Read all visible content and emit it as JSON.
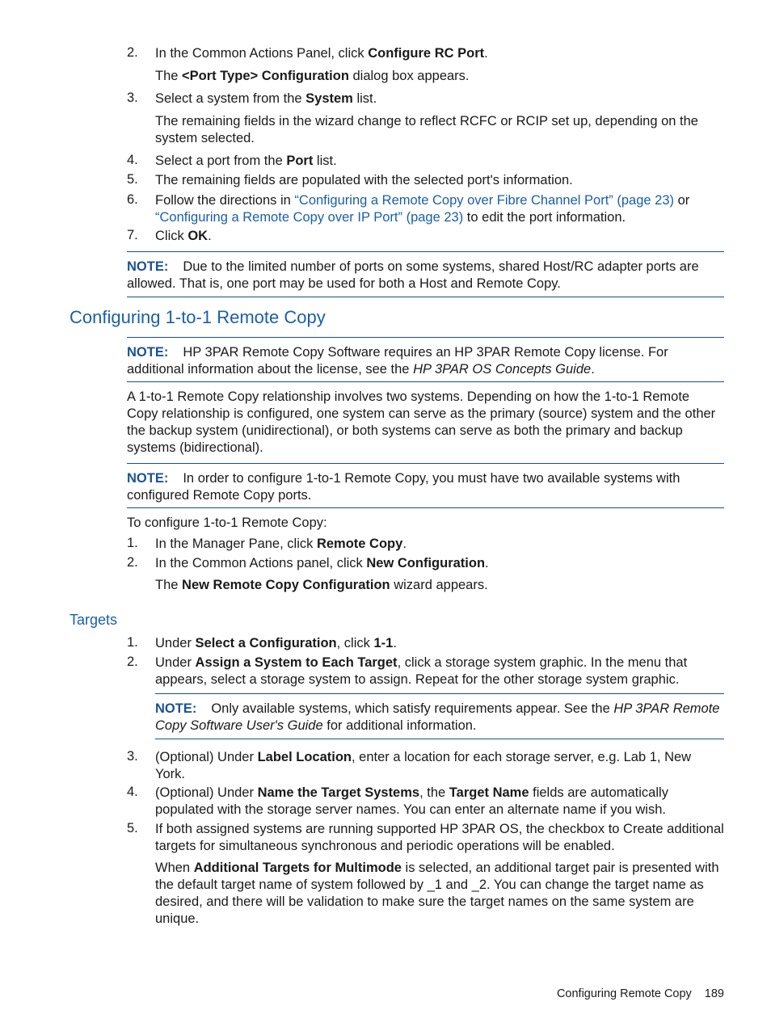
{
  "steps_top": [
    {
      "num": "2.",
      "pre": "In the Common Actions Panel, click ",
      "bold": "Configure RC Port",
      "post": "."
    },
    {
      "num": "3.",
      "pre": "Select a system from the ",
      "bold": "System",
      "post": " list."
    },
    {
      "num": "4.",
      "pre": "Select a port from the ",
      "bold": "Port",
      "post": " list."
    },
    {
      "num": "5.",
      "text": "The remaining fields are populated with the selected port's information."
    },
    {
      "num": "6.",
      "pre": "Follow the directions in ",
      "link1": "“Configuring a Remote Copy over Fibre Channel Port” (page 23)",
      "mid": " or ",
      "link2": "“Configuring a Remote Copy over IP Port” (page 23)",
      "post": " to edit the port information."
    },
    {
      "num": "7.",
      "pre": "Click ",
      "bold": "OK",
      "post": "."
    }
  ],
  "step2_result": {
    "pre": "The ",
    "bold": "<Port Type> Configuration",
    "post": " dialog box appears."
  },
  "step3_result": "The remaining fields in the wizard change to reflect RCFC or RCIP set up, depending on the system selected.",
  "note1": {
    "label": "NOTE:",
    "text": "Due to the limited number of ports on some systems, shared Host/RC adapter ports are allowed. That is, one port may be used for both a Host and Remote Copy."
  },
  "section_heading": "Configuring 1-to-1 Remote Copy",
  "note2": {
    "label": "NOTE:",
    "pre": "HP 3PAR Remote Copy Software requires an HP 3PAR Remote Copy license. For additional information about the license, see the ",
    "italic": "HP 3PAR OS Concepts Guide",
    "post": "."
  },
  "intro_paragraph": "A 1-to-1 Remote Copy relationship involves two systems. Depending on how the 1-to-1 Remote Copy relationship is configured, one system can serve as the primary (source) system and the other the backup system (unidirectional), or both systems can serve as both the primary and backup systems (bidirectional).",
  "note3": {
    "label": "NOTE:",
    "text": "In order to configure 1-to-1 Remote Copy, you must have two available systems with configured Remote Copy ports."
  },
  "procedure_intro": "To configure 1-to-1 Remote Copy:",
  "procedure_steps": [
    {
      "num": "1.",
      "pre": "In the Manager Pane, click ",
      "bold": "Remote Copy",
      "post": "."
    },
    {
      "num": "2.",
      "pre": "In the Common Actions panel, click ",
      "bold": "New Configuration",
      "post": "."
    }
  ],
  "procedure_result": {
    "pre": "The ",
    "bold": "New Remote Copy Configuration",
    "post": " wizard appears."
  },
  "subheading": "Targets",
  "target_steps": [
    {
      "num": "1.",
      "pre": "Under ",
      "bold": "Select a Configuration",
      "mid": ", click ",
      "bold2": "1-1",
      "post": "."
    },
    {
      "num": "2.",
      "pre": "Under ",
      "bold": "Assign a System to Each Target",
      "post": ", click a storage system graphic. In the menu that appears, select a storage system to assign. Repeat for the other storage system graphic."
    },
    {
      "num": "3.",
      "pre": "(Optional) Under ",
      "bold": "Label Location",
      "post": ", enter a location for each storage server, e.g. Lab 1, New York."
    },
    {
      "num": "4.",
      "pre": "(Optional) Under ",
      "bold": "Name the Target Systems",
      "mid": ", the ",
      "bold2": "Target Name",
      "post": " fields are automatically populated with the storage server names. You can enter an alternate name if you wish."
    },
    {
      "num": "5.",
      "text": "If both assigned systems are running supported HP 3PAR OS, the checkbox to Create additional targets for simultaneous synchronous and periodic operations will be enabled."
    }
  ],
  "note4": {
    "label": "NOTE:",
    "pre": "Only available systems, which satisfy requirements appear. See the ",
    "italic": "HP 3PAR Remote Copy Software User's Guide",
    "post": " for additional information."
  },
  "step5_result": {
    "pre": "When ",
    "bold": "Additional Targets for Multimode",
    "post": " is selected, an additional target pair is presented with the default target name of system followed by _1 and _2. You can change the target name as desired, and there will be validation to make sure the target names on the same system are unique."
  },
  "footer": {
    "section": "Configuring Remote Copy",
    "page": "189"
  }
}
